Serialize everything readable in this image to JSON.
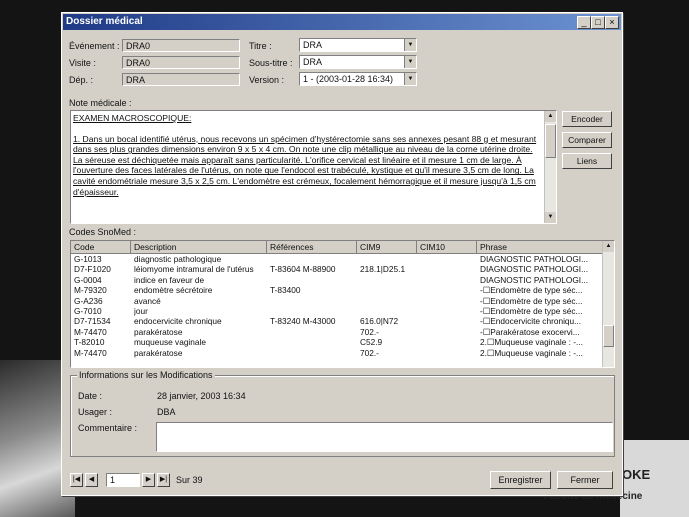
{
  "window": {
    "title": "Dossier médical"
  },
  "form": {
    "evenement": {
      "label": "Événement :",
      "value": "DRA0"
    },
    "visite": {
      "label": "Visite :",
      "value": "DRA0"
    },
    "dep": {
      "label": "Dép. :",
      "value": "DRA"
    },
    "titre": {
      "label": "Titre :",
      "value": "DRA"
    },
    "soustitre": {
      "label": "Sous-titre :",
      "value": "DRA"
    },
    "version": {
      "label": "Version :",
      "value": "1 - (2003-01-28 16:34)"
    }
  },
  "note": {
    "label": "Note médicale :",
    "heading": "EXAMEN MACROSCOPIQUE:",
    "body": "1.       Dans un bocal identifié utérus, nous recevons un spécimen d'hystérectomie sans ses annexes pesant 88 g et mesurant dans ses plus grandes dimensions environ 9 x 5 x 4 cm.  On note une clip métallique au niveau de la corne utérine droite.  La séreuse est déchiquetée mais apparaît sans particularité.  L'orifice cervical est linéaire et il mesure 1 cm de large.  À l'ouverture des faces latérales de l'utérus, on note que l'endocol est trabéculé, kystique et qu'il mesure 3,5 cm de long.  La cavité endométriale mesure 3,5 x 2,5 cm.  L'endomètre est crémeux, focalement hémorragique et il mesure jusqu'à 1,5 cm d'épaisseur."
  },
  "side_buttons": {
    "encoder": "Encoder",
    "comparer": "Comparer",
    "liens": "Liens"
  },
  "snomed": {
    "label": "Codes SnoMed :",
    "columns": [
      "Code",
      "Description",
      "Références",
      "CIM9",
      "CIM10",
      "Phrase"
    ],
    "rows": [
      [
        "G-1013",
        "diagnostic pathologique",
        "",
        "",
        "",
        "DIAGNOSTIC PATHOLOGI..."
      ],
      [
        "D7-F1020",
        "léiomyome intramural de l'utérus",
        "T-83604 M-88900",
        "218.1|D25.1",
        "",
        "DIAGNOSTIC PATHOLOGI..."
      ],
      [
        "G-0004",
        "indice en faveur de",
        "",
        "",
        "",
        "DIAGNOSTIC PATHOLOGI..."
      ],
      [
        "M-79320",
        "endomètre sécrétoire",
        "T-83400",
        "",
        "",
        "-☐Endomètre de type séc..."
      ],
      [
        "G-A236",
        "avancé",
        "",
        "",
        "",
        "-☐Endomètre de type séc..."
      ],
      [
        "G-7010",
        "jour",
        "",
        "",
        "",
        "-☐Endomètre de type séc..."
      ],
      [
        "D7-71534",
        "endocervicite chronique",
        "T-83240 M-43000",
        "616.0|N72",
        "",
        "-☐Endocervicite chroniqu..."
      ],
      [
        "M-74470",
        "parakératose",
        "",
        "702.-",
        "",
        "-☐Parakératose exocervi..."
      ],
      [
        "T-82010",
        "muqueuse vaginale",
        "",
        "C52.9",
        "",
        "2.☐Muqueuse vaginale : -..."
      ],
      [
        "M-74470",
        "parakératose",
        "",
        "702.-",
        "",
        "2.☐Muqueuse vaginale : -..."
      ]
    ]
  },
  "modifications": {
    "title": "Informations sur les Modifications",
    "date_label": "Date :",
    "date_value": "28 janvier, 2003 16:34",
    "user_label": "Usager :",
    "user_value": "DBA",
    "comment_label": "Commentaire :"
  },
  "navigation": {
    "page": "1",
    "total": "Sur 39"
  },
  "footer": {
    "save": "Enregistrer",
    "close": "Fermer"
  },
  "background": {
    "brand": "OKE",
    "faculty": "Faculté de médecine"
  }
}
